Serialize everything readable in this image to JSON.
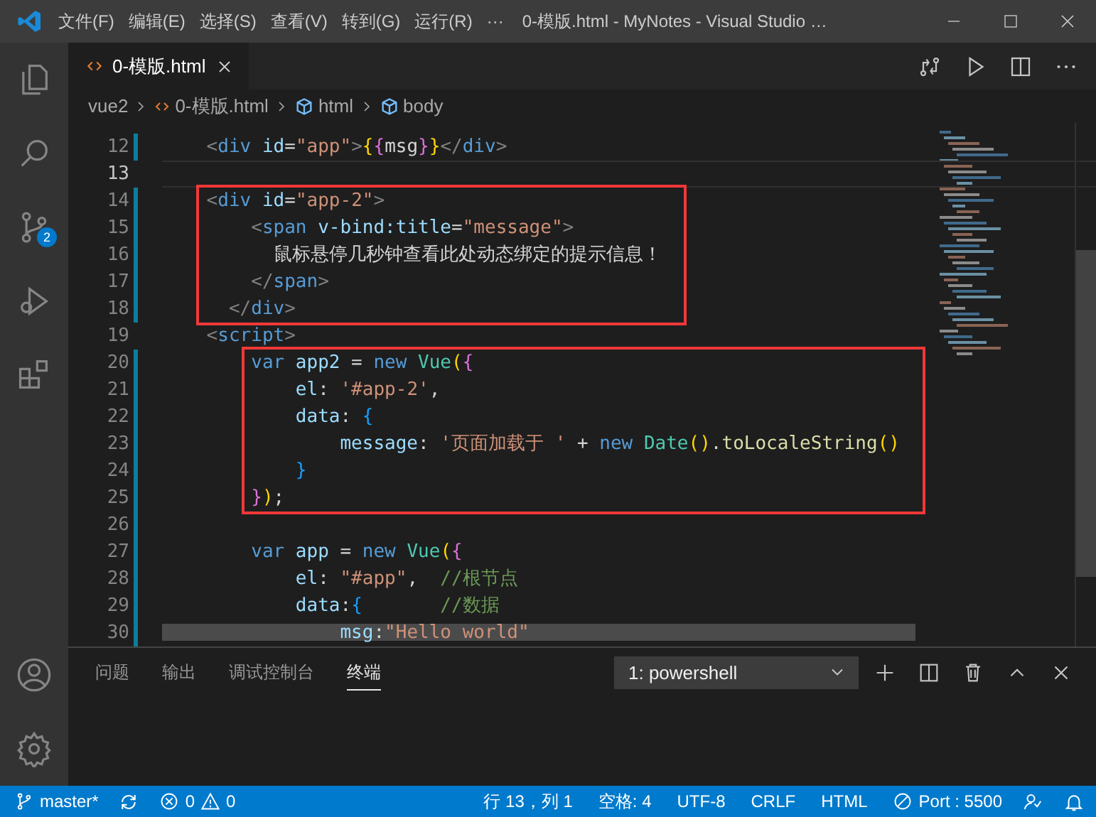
{
  "title_bar": {
    "menus": [
      "文件(F)",
      "编辑(E)",
      "选择(S)",
      "查看(V)",
      "转到(G)",
      "运行(R)"
    ],
    "overflow": "···",
    "title": "0-模版.html - MyNotes - Visual Studio …"
  },
  "activity_bar": {
    "items": [
      {
        "kind": "explorer"
      },
      {
        "kind": "search"
      },
      {
        "kind": "source-control",
        "badge": "2"
      },
      {
        "kind": "debug"
      },
      {
        "kind": "extensions"
      }
    ],
    "bottom": [
      {
        "kind": "account"
      },
      {
        "kind": "settings"
      }
    ]
  },
  "tabs": [
    {
      "label": "0-模版.html",
      "selected": true
    }
  ],
  "breadcrumb": [
    {
      "kind": "folder",
      "label": "vue2"
    },
    {
      "kind": "file",
      "label": "0-模版.html"
    },
    {
      "kind": "symbol",
      "label": "html"
    },
    {
      "kind": "symbol",
      "label": "body"
    }
  ],
  "editor": {
    "lines": [
      {
        "number": "12",
        "modified": true,
        "current": false,
        "annotated": false,
        "tokens": [
          {
            "text": "    <",
            "kind": "tagp"
          },
          {
            "text": "div",
            "kind": "tag"
          },
          {
            "text": " id",
            "kind": "attr"
          },
          {
            "text": "=",
            "kind": "text"
          },
          {
            "text": "\"app\"",
            "kind": "string"
          },
          {
            "text": ">",
            "kind": "tagp"
          },
          {
            "text": "{",
            "kind": "b1"
          },
          {
            "text": "{",
            "kind": "b2"
          },
          {
            "text": "msg",
            "kind": "text"
          },
          {
            "text": "}",
            "kind": "b2"
          },
          {
            "text": "}",
            "kind": "b1"
          },
          {
            "text": "</",
            "kind": "tagp"
          },
          {
            "text": "div",
            "kind": "tag"
          },
          {
            "text": ">",
            "kind": "tagp"
          }
        ]
      },
      {
        "number": "13",
        "modified": false,
        "current": true,
        "annotated": false
      },
      {
        "number": "14",
        "modified": true,
        "current": false,
        "annotated": true,
        "tokens": [
          {
            "text": "    <",
            "kind": "tagp"
          },
          {
            "text": "div",
            "kind": "tag"
          },
          {
            "text": " id",
            "kind": "attr"
          },
          {
            "text": "=",
            "kind": "text"
          },
          {
            "text": "\"app-2\"",
            "kind": "string"
          },
          {
            "text": ">",
            "kind": "tagp"
          }
        ]
      },
      {
        "number": "15",
        "modified": true,
        "current": false,
        "annotated": true,
        "tokens": [
          {
            "text": "        <",
            "kind": "tagp"
          },
          {
            "text": "span",
            "kind": "tag"
          },
          {
            "text": " v-bind:title",
            "kind": "attr"
          },
          {
            "text": "=",
            "kind": "text"
          },
          {
            "text": "\"message\"",
            "kind": "string"
          },
          {
            "text": ">",
            "kind": "tagp"
          }
        ]
      },
      {
        "number": "16",
        "modified": true,
        "current": false,
        "annotated": true,
        "tokens": [
          {
            "text": "          鼠标悬停几秒钟查看此处动态绑定的提示信息！",
            "kind": "text"
          }
        ]
      },
      {
        "number": "17",
        "modified": true,
        "current": false,
        "annotated": true,
        "tokens": [
          {
            "text": "        </",
            "kind": "tagp"
          },
          {
            "text": "span",
            "kind": "tag"
          },
          {
            "text": ">",
            "kind": "tagp"
          }
        ]
      },
      {
        "number": "18",
        "modified": true,
        "current": false,
        "annotated": true,
        "tokens": [
          {
            "text": "      </",
            "kind": "tagp"
          },
          {
            "text": "div",
            "kind": "tag"
          },
          {
            "text": ">",
            "kind": "tagp"
          }
        ]
      },
      {
        "number": "19",
        "modified": false,
        "current": false,
        "annotated": false,
        "tokens": [
          {
            "text": "    <",
            "kind": "tagp"
          },
          {
            "text": "script",
            "kind": "tag"
          },
          {
            "text": ">",
            "kind": "tagp"
          }
        ]
      },
      {
        "number": "20",
        "modified": true,
        "current": false,
        "annotated": true,
        "tokens": [
          {
            "text": "        var",
            "kind": "keyword"
          },
          {
            "text": " app2",
            "kind": "attr"
          },
          {
            "text": " = ",
            "kind": "text"
          },
          {
            "text": "new",
            "kind": "keyword"
          },
          {
            "text": " Vue",
            "kind": "class"
          },
          {
            "text": "(",
            "kind": "b1"
          },
          {
            "text": "{",
            "kind": "b2"
          }
        ]
      },
      {
        "number": "21",
        "modified": true,
        "current": false,
        "annotated": true,
        "tokens": [
          {
            "text": "            el",
            "kind": "attr"
          },
          {
            "text": ": ",
            "kind": "text"
          },
          {
            "text": "'#app-2'",
            "kind": "string"
          },
          {
            "text": ",",
            "kind": "text"
          }
        ]
      },
      {
        "number": "22",
        "modified": true,
        "current": false,
        "annotated": true,
        "tokens": [
          {
            "text": "            data",
            "kind": "attr"
          },
          {
            "text": ": ",
            "kind": "text"
          },
          {
            "text": "{",
            "kind": "b3"
          }
        ]
      },
      {
        "number": "23",
        "modified": true,
        "current": false,
        "annotated": true,
        "tokens": [
          {
            "text": "                message",
            "kind": "attr"
          },
          {
            "text": ": ",
            "kind": "text"
          },
          {
            "text": "'页面加载于 '",
            "kind": "string"
          },
          {
            "text": " + ",
            "kind": "text"
          },
          {
            "text": "new",
            "kind": "keyword"
          },
          {
            "text": " Date",
            "kind": "class"
          },
          {
            "text": "()",
            "kind": "b1"
          },
          {
            "text": ".",
            "kind": "text"
          },
          {
            "text": "toLocaleString",
            "kind": "func"
          },
          {
            "text": "()",
            "kind": "b1"
          }
        ]
      },
      {
        "number": "24",
        "modified": true,
        "current": false,
        "annotated": true,
        "tokens": [
          {
            "text": "            }",
            "kind": "b3"
          }
        ]
      },
      {
        "number": "25",
        "modified": true,
        "current": false,
        "annotated": true,
        "tokens": [
          {
            "text": "        }",
            "kind": "b2"
          },
          {
            "text": ")",
            "kind": "b1"
          },
          {
            "text": ";",
            "kind": "text"
          }
        ]
      },
      {
        "number": "26",
        "modified": true,
        "current": false,
        "annotated": false
      },
      {
        "number": "27",
        "modified": true,
        "current": false,
        "annotated": false,
        "tokens": [
          {
            "text": "        var",
            "kind": "keyword"
          },
          {
            "text": " app",
            "kind": "attr"
          },
          {
            "text": " = ",
            "kind": "text"
          },
          {
            "text": "new",
            "kind": "keyword"
          },
          {
            "text": " Vue",
            "kind": "class"
          },
          {
            "text": "(",
            "kind": "b1"
          },
          {
            "text": "{",
            "kind": "b2"
          }
        ]
      },
      {
        "number": "28",
        "modified": true,
        "current": false,
        "annotated": false,
        "tokens": [
          {
            "text": "            el",
            "kind": "attr"
          },
          {
            "text": ": ",
            "kind": "text"
          },
          {
            "text": "\"#app\"",
            "kind": "string"
          },
          {
            "text": ",",
            "kind": "text"
          },
          {
            "text": "  //根节点",
            "kind": "comment"
          }
        ]
      },
      {
        "number": "29",
        "modified": true,
        "current": false,
        "annotated": false,
        "tokens": [
          {
            "text": "            data",
            "kind": "attr"
          },
          {
            "text": ":",
            "kind": "text"
          },
          {
            "text": "{",
            "kind": "b3"
          },
          {
            "text": "       //数据",
            "kind": "comment"
          }
        ]
      },
      {
        "number": "30",
        "modified": true,
        "current": false,
        "annotated": false,
        "tokens": [
          {
            "text": "                msg",
            "kind": "attr"
          },
          {
            "text": ":",
            "kind": "text"
          },
          {
            "text": "\"Hello world\"",
            "kind": "string"
          }
        ]
      }
    ]
  },
  "panel": {
    "tabs": [
      {
        "label": "问题",
        "selected": false
      },
      {
        "label": "输出",
        "selected": false
      },
      {
        "label": "调试控制台",
        "selected": false
      },
      {
        "label": "终端",
        "selected": true
      }
    ],
    "terminal_select": "1: powershell"
  },
  "status_bar": {
    "branch": "master*",
    "errors": "0",
    "warnings": "0",
    "items": [
      "行 13，列 1",
      "空格: 4",
      "UTF-8",
      "CRLF",
      "HTML"
    ],
    "port": "Port : 5500"
  }
}
